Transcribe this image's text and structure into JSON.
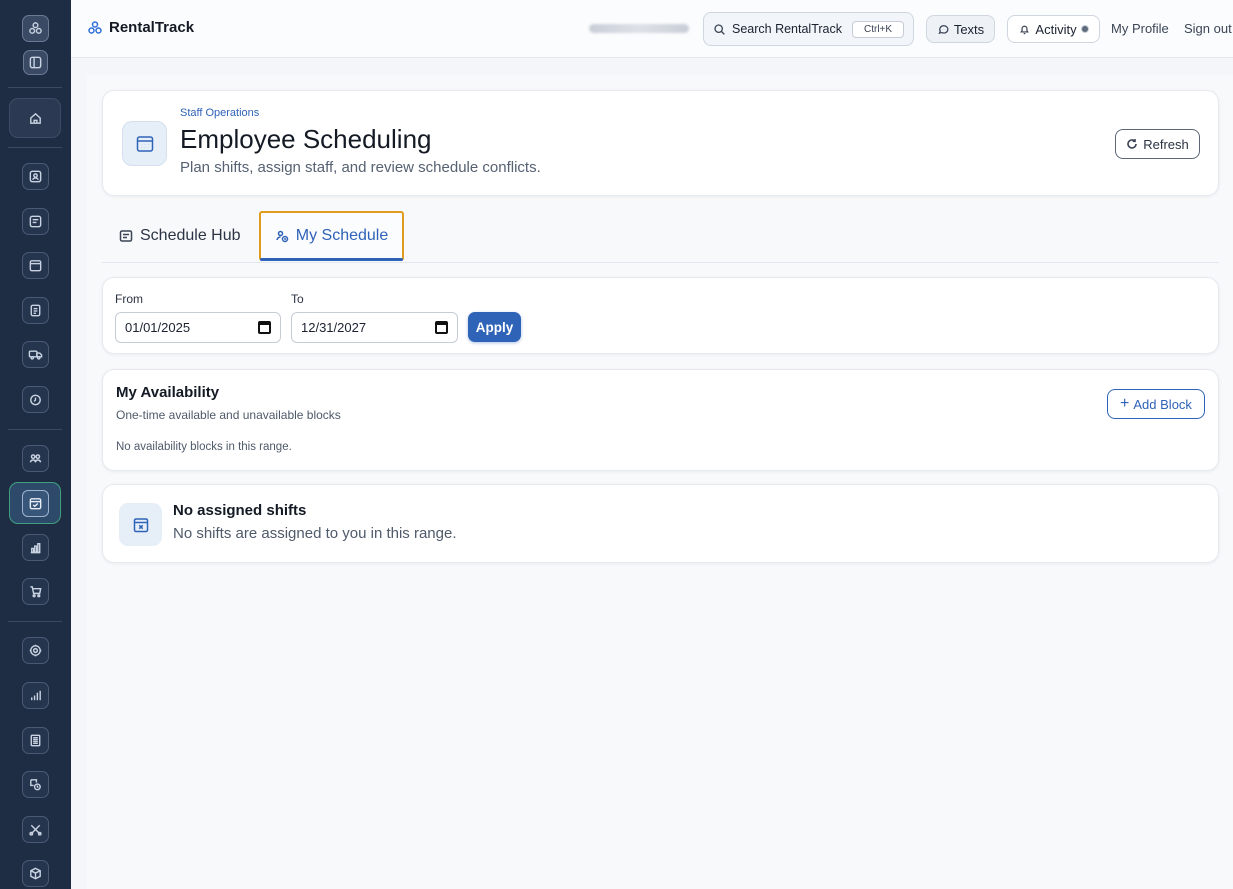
{
  "app": {
    "brand": "RentalTrack"
  },
  "topbar": {
    "search_label": "Search RentalTrack",
    "search_shortcut": "Ctrl+K",
    "texts_label": "Texts",
    "activity_label": "Activity",
    "profile_label": "My Profile",
    "signout_label": "Sign out"
  },
  "header": {
    "eyebrow": "Staff Operations",
    "title": "Employee Scheduling",
    "subtitle": "Plan shifts, assign staff, and review schedule conflicts.",
    "refresh_label": "Refresh"
  },
  "tabs": [
    {
      "label": "Schedule Hub",
      "active": false
    },
    {
      "label": "My Schedule",
      "active": true
    }
  ],
  "filters": {
    "from_label": "From",
    "from_value": "01/01/2025",
    "to_label": "To",
    "to_value": "12/31/2027",
    "apply_label": "Apply"
  },
  "availability": {
    "title": "My Availability",
    "subtitle": "One-time available and unavailable blocks",
    "empty_text": "No availability blocks in this range.",
    "add_label": "Add Block"
  },
  "shifts": {
    "title": "No assigned shifts",
    "subtitle": "No shifts are assigned to you in this range."
  },
  "sidebar": {
    "icons": [
      "logo-icon",
      "panel-toggle-icon",
      "home-icon",
      "contacts-icon",
      "reservations-icon",
      "calendar-icon",
      "documents-icon",
      "delivery-truck-icon",
      "clock-icon",
      "team-icon",
      "scheduling-icon",
      "reports-icon",
      "cart-icon",
      "settings-icon",
      "analytics-icon",
      "ledger-icon",
      "pricing-icon",
      "tools-icon",
      "inventory-icon"
    ]
  },
  "colors": {
    "accent": "#2f63b8",
    "sidebar": "#1f2d44",
    "tab_focus": "#e09c1e",
    "active_nav_border": "#3fa07f"
  }
}
